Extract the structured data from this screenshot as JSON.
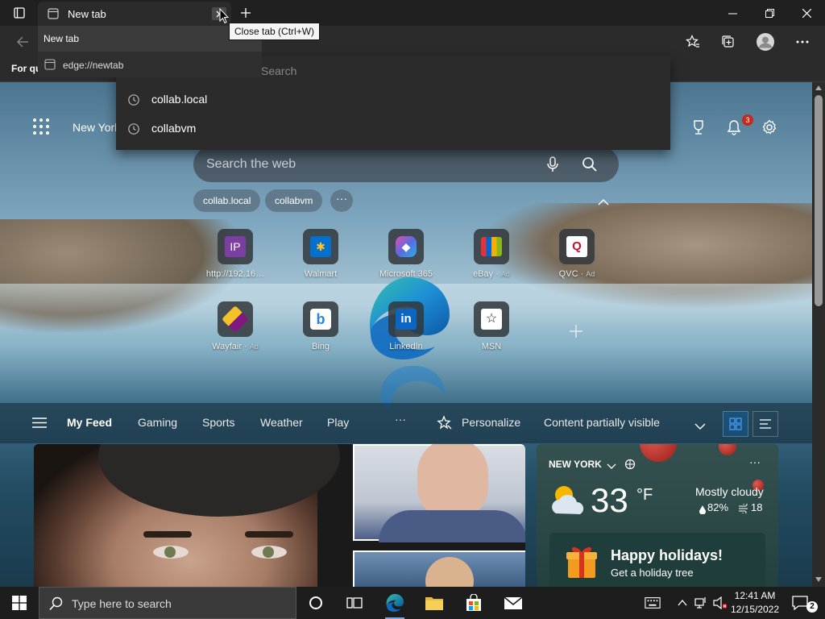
{
  "browser": {
    "tab_title": "New tab",
    "close_tooltip": "Close tab (Ctrl+W)",
    "preview_title": "New tab",
    "preview_url": "edge://newtab",
    "address_placeholder": "Search",
    "favorites_bar_text": "For qu",
    "suggestions": [
      {
        "label": "collab.local",
        "icon": "history-icon"
      },
      {
        "label": "collabvm",
        "icon": "history-icon"
      }
    ]
  },
  "ntp": {
    "location": "New York",
    "notification_count": "3",
    "search_placeholder": "Search the web",
    "chips": [
      "collab.local",
      "collabvm"
    ],
    "chips_more": "···",
    "tiles_row1": [
      {
        "label": "http://192.16…",
        "ad": "",
        "icon": "ip-icon",
        "glyph": "IP",
        "color": "#7a3fa0"
      },
      {
        "label": "Walmart",
        "ad": "",
        "icon": "walmart-icon",
        "glyph": "✱",
        "color": "#0071ce"
      },
      {
        "label": "Microsoft 365",
        "ad": "",
        "icon": "microsoft365-icon",
        "glyph": "◆",
        "color": "#6b5cd6"
      },
      {
        "label": "eBay",
        "ad": "Ad",
        "icon": "ebay-icon",
        "glyph": "■",
        "color": "#e53238"
      },
      {
        "label": "QVC",
        "ad": "Ad",
        "icon": "qvc-icon",
        "glyph": "Q",
        "color": "#c8102e"
      }
    ],
    "tiles_row2": [
      {
        "label": "Wayfair",
        "ad": "Ad",
        "icon": "wayfair-icon",
        "glyph": "◆",
        "color": "#7f187f"
      },
      {
        "label": "Bing",
        "ad": "",
        "icon": "bing-icon",
        "glyph": "b",
        "color": "#2b87d3"
      },
      {
        "label": "LinkedIn",
        "ad": "",
        "icon": "linkedin-icon",
        "glyph": "in",
        "color": "#0a66c2"
      },
      {
        "label": "MSN",
        "ad": "",
        "icon": "msn-icon",
        "glyph": "☆",
        "color": "#222222"
      }
    ]
  },
  "feed": {
    "nav": [
      "My Feed",
      "Gaming",
      "Sports",
      "Weather",
      "Play"
    ],
    "more": "···",
    "personalize": "Personalize",
    "content_visibility": "Content partially visible"
  },
  "weather": {
    "location": "NEW YORK",
    "temperature": "33",
    "unit": "°F",
    "condition": "Mostly cloudy",
    "humidity": "82%",
    "wind": "18",
    "holiday_title": "Happy holidays!",
    "holiday_subtitle": "Get a holiday tree"
  },
  "taskbar": {
    "search_placeholder": "Type here to search",
    "time": "12:41 AM",
    "date": "12/15/2022",
    "notification_count": "2"
  },
  "colors": {
    "accent": "#0078d4",
    "badge_red": "#c42b1c",
    "titlebar": "#202020",
    "toolbar": "#2b2b2b"
  }
}
